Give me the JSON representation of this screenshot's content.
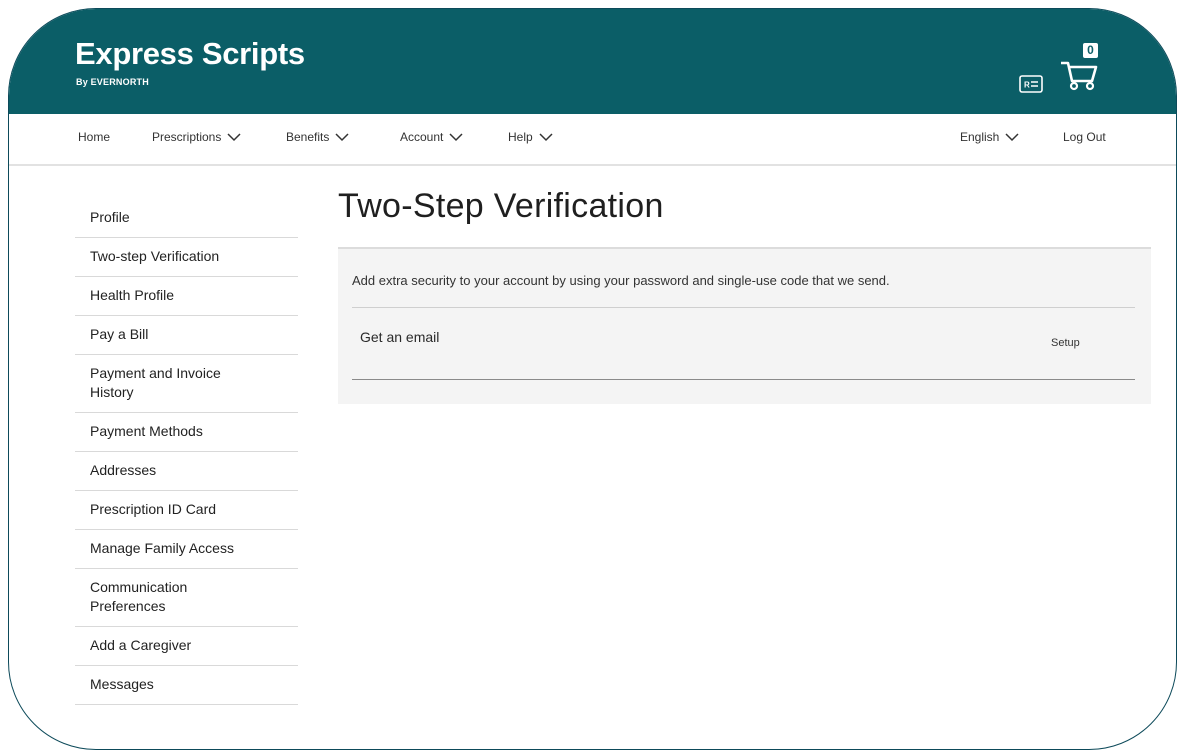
{
  "brand": {
    "name": "Express Scripts",
    "sub": "By EVERNORTH"
  },
  "header": {
    "cart_count": "0",
    "icons": [
      "id-card-icon",
      "cart-icon"
    ]
  },
  "nav": {
    "home": "Home",
    "prescriptions": "Prescriptions",
    "benefits": "Benefits",
    "account": "Account",
    "help": "Help",
    "language": "English",
    "logout": "Log Out"
  },
  "sidebar": {
    "items": [
      {
        "label": "Profile"
      },
      {
        "label": "Two-step Verification"
      },
      {
        "label": "Health Profile"
      },
      {
        "label": "Pay a Bill"
      },
      {
        "label": "Payment and Invoice History"
      },
      {
        "label": "Payment Methods"
      },
      {
        "label": "Addresses"
      },
      {
        "label": "Prescription ID Card"
      },
      {
        "label": "Manage Family Access"
      },
      {
        "label": "Communication Preferences"
      },
      {
        "label": "Add a Caregiver"
      },
      {
        "label": "Messages"
      }
    ]
  },
  "main": {
    "title": "Two-Step Verification",
    "description": "Add extra security to your account by using your password and single-use code that we send.",
    "option_label": "Get an email",
    "option_action": "Setup"
  },
  "colors": {
    "brand_teal": "#0b5e67",
    "panel_bg": "#f4f4f4"
  }
}
